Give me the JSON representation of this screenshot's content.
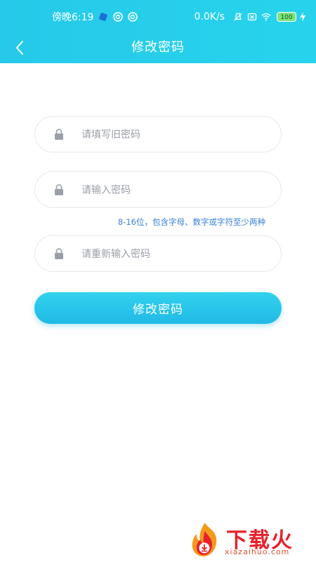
{
  "status_bar": {
    "time": "傍晚6:19",
    "net_speed": "0.0K/s",
    "battery": "100",
    "left_icons": [
      "app-notification-icon",
      "app-notification-icon",
      "app-notification-icon"
    ],
    "right_icons": [
      "mute-icon",
      "sim-icon",
      "wifi-icon",
      "battery-icon",
      "charging-icon"
    ]
  },
  "nav": {
    "title": "修改密码",
    "back_icon": "back-arrow-icon"
  },
  "form": {
    "old_password": {
      "placeholder": "请填写旧密码",
      "value": ""
    },
    "new_password": {
      "placeholder": "请输入密码",
      "value": ""
    },
    "hint": "8-16位，包含字母、数字或字符至少两种",
    "confirm_password": {
      "placeholder": "请重新输入密码",
      "value": ""
    },
    "submit_label": "修改密码",
    "field_icon": "lock-icon"
  },
  "watermark": {
    "brand": "下载火",
    "url": "xiazaihuo.com"
  },
  "colors": {
    "accent": "#26c9e9",
    "hint": "#3a7fd6",
    "watermark": "#e8202a"
  }
}
